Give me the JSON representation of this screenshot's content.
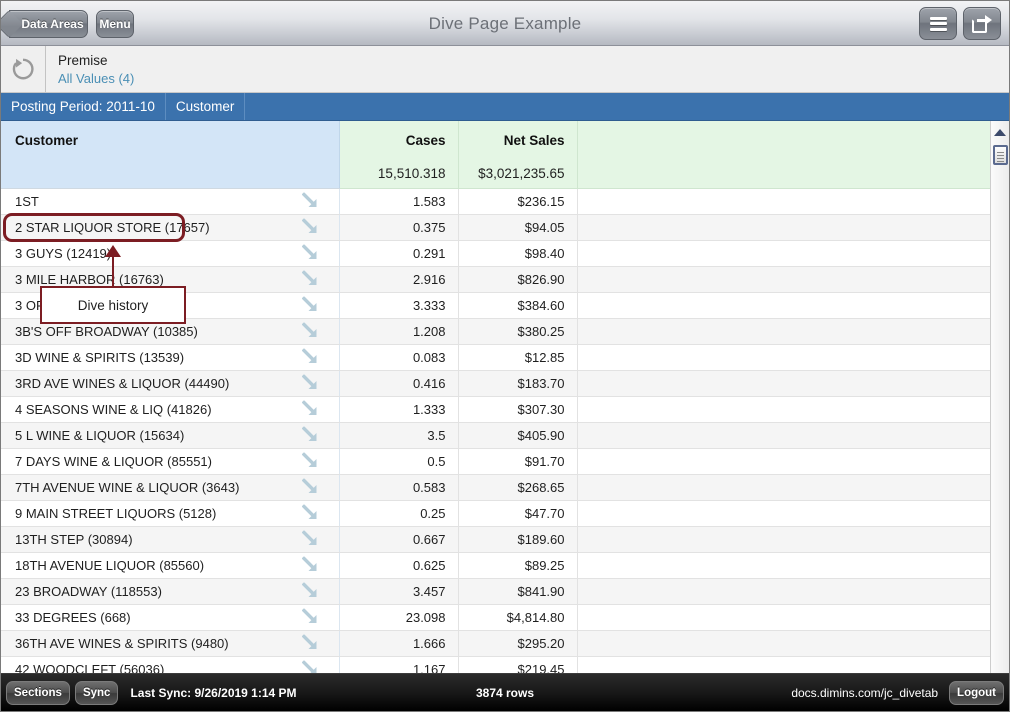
{
  "titlebar": {
    "back_label": "Data Areas",
    "menu_label": "Menu",
    "title": "Dive Page Example",
    "hamburger_icon": "hamburger-menu-icon",
    "share_icon": "share-export-icon"
  },
  "filterbar": {
    "refresh_icon": "refresh-reset-icon",
    "dimension": "Premise",
    "selection": "All Values (4)"
  },
  "breadcrumb": {
    "items": [
      {
        "label": "Posting Period: 2011-10",
        "highlighted": true
      },
      {
        "label": "Customer",
        "highlighted": false
      }
    ]
  },
  "annotation": {
    "label": "Dive history",
    "color": "#7c1d23"
  },
  "grid": {
    "columns": [
      {
        "label": "Customer",
        "align": "left",
        "type": "dimension"
      },
      {
        "label": "Cases",
        "align": "right",
        "type": "measure"
      },
      {
        "label": "Net Sales",
        "align": "right",
        "type": "measure"
      }
    ],
    "totals": {
      "cases": "15,510.318",
      "net_sales": "$3,021,235.65"
    },
    "dive_icon": "dive-down-right-arrow-icon",
    "rows": [
      {
        "customer": "1ST",
        "cases": "1.583",
        "net_sales": "$236.15"
      },
      {
        "customer": "2 STAR LIQUOR STORE (17657)",
        "cases": "0.375",
        "net_sales": "$94.05"
      },
      {
        "customer": "3 GUYS (12419)",
        "cases": "0.291",
        "net_sales": "$98.40"
      },
      {
        "customer": "3 MILE HARBOR (16763)",
        "cases": "2.916",
        "net_sales": "$826.90"
      },
      {
        "customer": "3 OF CUPS (4988)",
        "cases": "3.333",
        "net_sales": "$384.60"
      },
      {
        "customer": "3B'S OFF BROADWAY (10385)",
        "cases": "1.208",
        "net_sales": "$380.25"
      },
      {
        "customer": "3D WINE & SPIRITS (13539)",
        "cases": "0.083",
        "net_sales": "$12.85"
      },
      {
        "customer": "3RD AVE WINES & LIQUOR (44490)",
        "cases": "0.416",
        "net_sales": "$183.70"
      },
      {
        "customer": "4 SEASONS WINE & LIQ (41826)",
        "cases": "1.333",
        "net_sales": "$307.30"
      },
      {
        "customer": "5 L WINE & LIQUOR (15634)",
        "cases": "3.5",
        "net_sales": "$405.90"
      },
      {
        "customer": "7 DAYS WINE & LIQUOR (85551)",
        "cases": "0.5",
        "net_sales": "$91.70"
      },
      {
        "customer": "7TH AVENUE WINE & LIQUOR (3643)",
        "cases": "0.583",
        "net_sales": "$268.65"
      },
      {
        "customer": "9 MAIN STREET LIQUORS (5128)",
        "cases": "0.25",
        "net_sales": "$47.70"
      },
      {
        "customer": "13TH STEP (30894)",
        "cases": "0.667",
        "net_sales": "$189.60"
      },
      {
        "customer": "18TH AVENUE LIQUOR (85560)",
        "cases": "0.625",
        "net_sales": "$89.25"
      },
      {
        "customer": "23 BROADWAY (118553)",
        "cases": "3.457",
        "net_sales": "$841.90"
      },
      {
        "customer": "33 DEGREES (668)",
        "cases": "23.098",
        "net_sales": "$4,814.80"
      },
      {
        "customer": "36TH AVE WINES & SPIRITS (9480)",
        "cases": "1.666",
        "net_sales": "$295.20"
      },
      {
        "customer": "42 WOODCLEFT (56036)",
        "cases": "1.167",
        "net_sales": "$219.45"
      }
    ]
  },
  "scrollbar": {
    "up_icon": "scroll-up-arrow-icon",
    "thumb_icon": "scroll-thumb-grip"
  },
  "footer": {
    "sections_label": "Sections",
    "sync_label": "Sync",
    "last_sync": "Last Sync: 9/26/2019 1:14 PM",
    "row_count": "3874 rows",
    "url": "docs.dimins.com/jc_divetab",
    "logout_label": "Logout"
  }
}
